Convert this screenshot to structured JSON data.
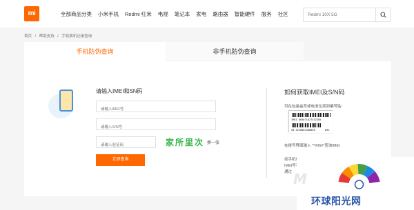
{
  "header": {
    "logo": "mi",
    "nav": [
      "全部商品分类",
      "小米手机",
      "Redmi 红米",
      "电视",
      "笔记本",
      "家电",
      "路由器",
      "智能硬件",
      "服务",
      "社区"
    ],
    "search_placeholder": "Redmi 10X 5G"
  },
  "breadcrumb": [
    "首页",
    "/",
    "帮助支持",
    "/",
    "手机换机记录查询"
  ],
  "tabs": {
    "active": "手机防伪查询",
    "inactive": "非手机防伪查询"
  },
  "form": {
    "title": "请输入IMEI和SN码",
    "imei_placeholder": "请输入IMEI号",
    "sn_placeholder": "请输入S/N号",
    "captcha_placeholder": "请输入验证码",
    "captcha_text": "家所里次",
    "refresh_label": "换一张",
    "submit_label": "立即查询"
  },
  "help": {
    "title": "如何获取IMEI及S/N码",
    "subtitle": "可在包装盒背或电池位找到编号贴:",
    "barcode_lines": [
      "IMEI 865671027432305",
      "SN 4250003488858",
      "892"
    ],
    "line1": "在拨号界面输入 \"*#06#\"查询IMEI",
    "line2": "如手机包装上",
    "line3": "IMEI号不同,",
    "line4": "通过"
  },
  "watermark": {
    "text": "环球阳光网"
  },
  "colors": {
    "accent": "#ff6700",
    "captcha": "#39b54a",
    "watermark": "#2a55a8"
  }
}
